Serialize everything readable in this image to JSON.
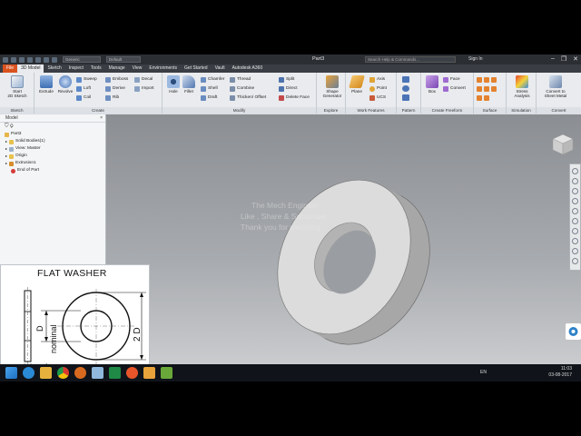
{
  "title_bar": {
    "style_combo": "Generic",
    "appearance_combo": "Default",
    "document_name": "Part3",
    "search_placeholder": "Search Help & Commands...",
    "signin_label": "Sign In"
  },
  "ribbon_tabs": [
    "File",
    "3D Model",
    "Sketch",
    "Inspect",
    "Tools",
    "Manage",
    "View",
    "Environments",
    "Get Started",
    "Vault",
    "Autodesk A360"
  ],
  "active_tab": "3D Model",
  "ribbon": {
    "sketch": {
      "start_label_1": "Start",
      "start_label_2": "2D Sketch",
      "group": "Sketch"
    },
    "create": {
      "extrude": "Extrude",
      "revolve": "Revolve",
      "sweep": "Sweep",
      "loft": "Loft",
      "coil": "Coil",
      "emboss": "Emboss",
      "derive": "Derive",
      "rib": "Rib",
      "decal": "Decal",
      "import": "Import",
      "group": "Create"
    },
    "modify": {
      "hole": "Hole",
      "fillet": "Fillet",
      "chamfer": "Chamfer",
      "shell": "Shell",
      "draft": "Draft",
      "thread": "Thread",
      "combine": "Combine",
      "thicken": "Thicken/ Offset",
      "split": "Split",
      "direct": "Direct",
      "delete_face": "Delete Face",
      "group": "Modify"
    },
    "explore": {
      "shape_gen_1": "Shape",
      "shape_gen_2": "Generator",
      "group": "Explore"
    },
    "work_features": {
      "plane": "Plane",
      "axis": "Axis",
      "point": "Point",
      "ucs": "UCS",
      "group": "Work Features"
    },
    "pattern": {
      "group": "Pattern"
    },
    "freeform": {
      "box": "Box",
      "face": "Face",
      "convert": "Convert",
      "group": "Create Freeform"
    },
    "surface": {
      "group": "Surface"
    },
    "simulation": {
      "stress_1": "Stress",
      "stress_2": "Analysis",
      "group": "Simulation"
    },
    "convert": {
      "sheet_1": "Convert to",
      "sheet_2": "Sheet Metal",
      "group": "Convert"
    }
  },
  "browser": {
    "header": "Model",
    "nodes": [
      "Part3",
      "Solid Bodies(1)",
      "View: Master",
      "Origin",
      "Extrusion1",
      "End of Part"
    ]
  },
  "viewport": {
    "watermark_lines": [
      "The Mech Engineer",
      "Like , Share & Subscribe",
      "Thank you for watching"
    ]
  },
  "drawing": {
    "title": "FLAT WASHER",
    "label_d": "D",
    "label_nominal": "nominal",
    "label_2d": "2 D",
    "label_t": "t"
  },
  "taskbar": {
    "lang": "EN",
    "time": "11:03",
    "date": "03-08-2017"
  },
  "colors": {
    "file_tab": "#d9531e",
    "ribbon_bg": "#e9ebee",
    "viewport_top": "#8b8e92",
    "washer_face": "#d9d9d9",
    "washer_edge": "#a9a9a9"
  }
}
